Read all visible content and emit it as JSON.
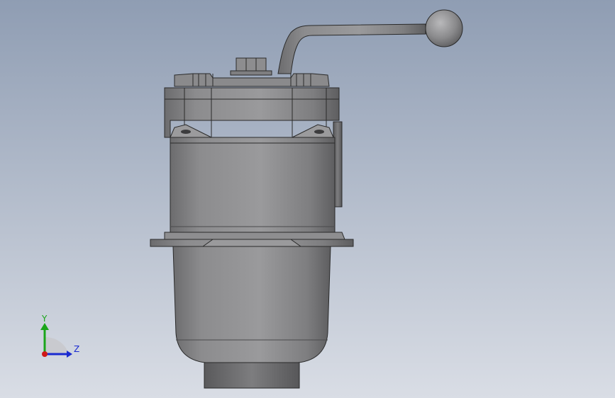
{
  "viewport": {
    "background_top": "#8f9db3",
    "background_bottom": "#d9dde5",
    "model_color": "#8a8a8c",
    "edge_color": "#2a2a2a"
  },
  "triad": {
    "y_label": "Y",
    "z_label": "Z",
    "y_color": "#1aa51a",
    "z_color": "#1a2ad0",
    "origin_color": "#d01818"
  }
}
